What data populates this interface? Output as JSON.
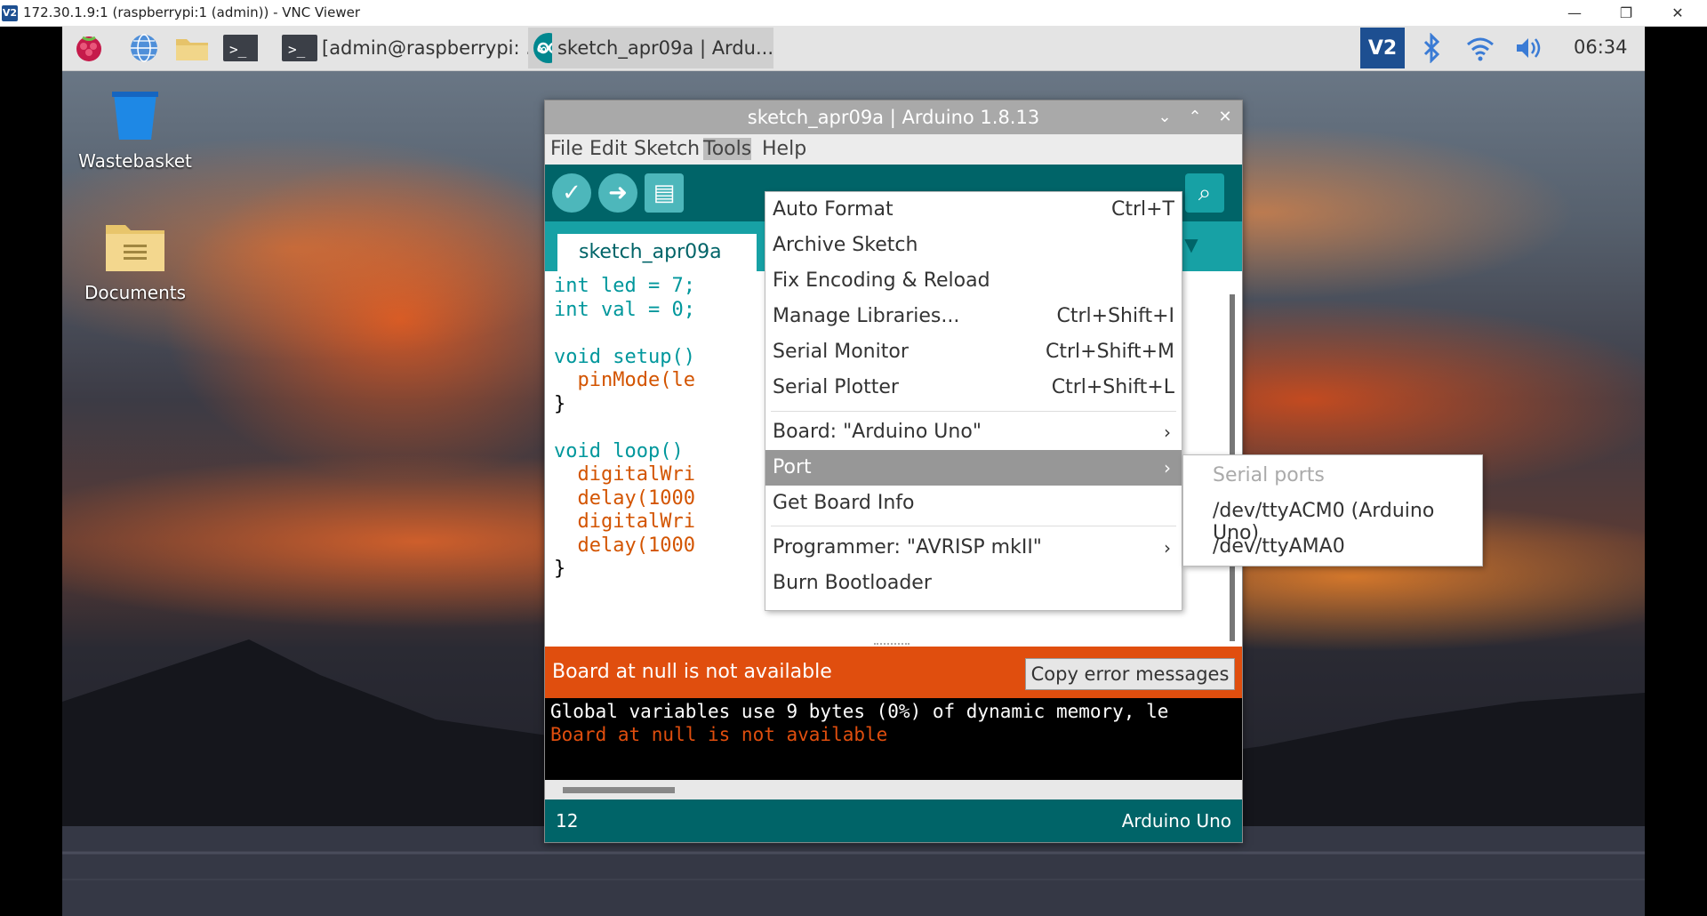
{
  "vnc": {
    "title": "172.30.1.9:1 (raspberrypi:1 (admin)) - VNC Viewer",
    "logo": "V2",
    "minimize": "—",
    "restore": "❐",
    "close": "✕"
  },
  "taskbar": {
    "tasks": [
      {
        "label": "[admin@raspberrypi: ..."
      },
      {
        "label": "sketch_apr09a | Ardu..."
      }
    ],
    "clock": "06:34",
    "tray_logo": "V2"
  },
  "desktop": {
    "icons": [
      {
        "label": "Wastebasket",
        "icon": "wastebasket-icon"
      },
      {
        "label": "Documents",
        "icon": "folder-icon"
      }
    ]
  },
  "arduino": {
    "title": "sketch_apr09a | Arduino 1.8.13",
    "menus": [
      "File",
      "Edit",
      "Sketch",
      "Tools",
      "Help"
    ],
    "tab": "sketch_apr09a",
    "code_lines": [
      "int led = 7;",
      "int val = 0;",
      "",
      "void setup()",
      "  pinMode(le",
      "}",
      "",
      "void loop()",
      "  digitalWri",
      "  delay(1000",
      "  digitalWri",
      "  delay(1000",
      "}"
    ],
    "error_message": "Board at null is not available",
    "copy_button": "Copy error messages",
    "console_lines": [
      "Global variables use 9 bytes (0%) of dynamic memory, le",
      "Board at null is not available"
    ],
    "status_line": "12",
    "status_board": "Arduino Uno"
  },
  "tools_menu": {
    "items": [
      {
        "label": "Auto Format",
        "shortcut": "Ctrl+T"
      },
      {
        "label": "Archive Sketch",
        "shortcut": ""
      },
      {
        "label": "Fix Encoding & Reload",
        "shortcut": ""
      },
      {
        "label": "Manage Libraries...",
        "shortcut": "Ctrl+Shift+I"
      },
      {
        "label": "Serial Monitor",
        "shortcut": "Ctrl+Shift+M"
      },
      {
        "label": "Serial Plotter",
        "shortcut": "Ctrl+Shift+L"
      },
      {
        "label": "Board: \"Arduino Uno\"",
        "shortcut": "›"
      },
      {
        "label": "Port",
        "shortcut": "›"
      },
      {
        "label": "Get Board Info",
        "shortcut": ""
      },
      {
        "label": "Programmer: \"AVRISP mkII\"",
        "shortcut": "›"
      },
      {
        "label": "Burn Bootloader",
        "shortcut": ""
      }
    ]
  },
  "port_menu": {
    "header": "Serial ports",
    "ports": [
      "/dev/ttyACM0 (Arduino Uno)",
      "/dev/ttyAMA0"
    ]
  },
  "colors": {
    "arduino_teal": "#006468",
    "arduino_tab": "#17a1a5",
    "error_orange": "#e04e0e",
    "menu_highlight": "#979797"
  }
}
